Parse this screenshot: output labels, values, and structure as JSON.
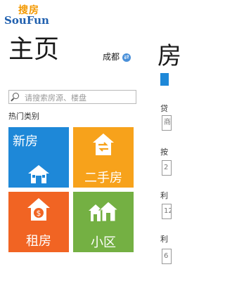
{
  "logo": {
    "top_text": "搜房",
    "bottom_text": "SouFun"
  },
  "header": {
    "title": "主页",
    "city": "成都"
  },
  "search": {
    "placeholder": "请搜索房源、楼盘"
  },
  "section_label": "热门类别",
  "tiles": [
    {
      "label": "新房",
      "color": "#1e88d8",
      "icon": "house-icon"
    },
    {
      "label": "二手房",
      "color": "#f7a21b",
      "icon": "house-exchange-icon"
    },
    {
      "label": "租房",
      "color": "#f16423",
      "icon": "house-money-icon"
    },
    {
      "label": "小区",
      "color": "#74b043",
      "icon": "houses-icon"
    }
  ],
  "right_panel": {
    "title": "房",
    "labels": [
      "贷",
      "按",
      "利",
      "利"
    ],
    "inputs": [
      "商",
      "2",
      "12",
      "6"
    ]
  }
}
